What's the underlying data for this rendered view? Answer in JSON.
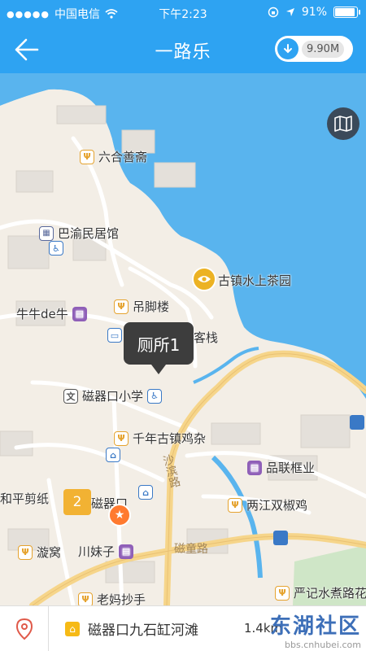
{
  "status": {
    "carrier": "中国电信",
    "time": "下午2:23",
    "battery": "91%",
    "battery_fraction": 0.91
  },
  "nav": {
    "title": "一路乐",
    "download_size": "9.90M"
  },
  "map": {
    "pois": [
      {
        "name": "六合善斋",
        "icon": "food"
      },
      {
        "name": "巴渝民居馆",
        "icon": "museum"
      },
      {
        "name": "古镇水上茶园",
        "icon": "scenic"
      },
      {
        "name": "牛牛de牛",
        "icon": "shop"
      },
      {
        "name": "吊脚楼",
        "icon": "food"
      },
      {
        "name": "客栈",
        "icon": "hotel"
      },
      {
        "name": "磁器口小学",
        "icon": "school"
      },
      {
        "name": "千年古镇鸡杂",
        "icon": "food"
      },
      {
        "name": "品联框业",
        "icon": "shop"
      },
      {
        "name": "和平剪纸",
        "icon": "shop"
      },
      {
        "name": "磁器口",
        "icon": "poi"
      },
      {
        "name": "两江双椒鸡",
        "icon": "food"
      },
      {
        "name": "漩窝",
        "icon": "food"
      },
      {
        "name": "川妹子",
        "icon": "shop"
      },
      {
        "name": "严记水煮路花",
        "icon": "food"
      },
      {
        "name": "老妈抄手",
        "icon": "food"
      }
    ],
    "roads": [
      "沙滨路",
      "磁童路"
    ],
    "callout": "厕所1",
    "cluster_count": "2"
  },
  "bottom": {
    "place": "磁器口九石缸河滩",
    "tail_text": "1.4km"
  },
  "watermark": {
    "text": "东湖社区",
    "url": "bbs.cnhubei.com"
  },
  "colors": {
    "primary": "#2ea3f2",
    "water": "#59b4ee",
    "callout": "#3d3d3d",
    "cluster": "#f2b233"
  }
}
